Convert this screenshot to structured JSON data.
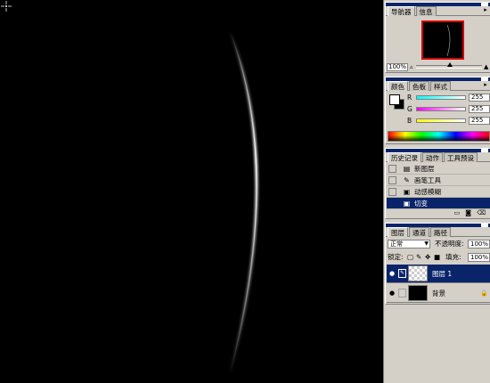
{
  "navigator": {
    "tabs": [
      "导航器",
      "信息"
    ],
    "zoom": "100%",
    "zoom_out_icon": "mountain-small-icon",
    "zoom_in_icon": "mountain-large-icon"
  },
  "color": {
    "tabs": [
      "颜色",
      "色板",
      "样式"
    ],
    "channels": [
      {
        "label": "R",
        "value": "255",
        "gradient": "#00ffff"
      },
      {
        "label": "G",
        "value": "255",
        "gradient": "#ff00ff"
      },
      {
        "label": "B",
        "value": "255",
        "gradient": "#ffff00"
      }
    ],
    "foreground": "#ffffff",
    "background": "#000000"
  },
  "history": {
    "tabs": [
      "历史记录",
      "动作",
      "工具预设"
    ],
    "items": [
      {
        "label": "新图层",
        "icon": "new-layer-icon",
        "selected": false
      },
      {
        "label": "画笔工具",
        "icon": "brush-icon",
        "selected": false
      },
      {
        "label": "动感模糊",
        "icon": "filter-icon",
        "selected": false
      },
      {
        "label": "切变",
        "icon": "filter-icon",
        "selected": true
      }
    ]
  },
  "layers": {
    "tabs": [
      "图层",
      "通道",
      "路径"
    ],
    "blend_mode": "正常",
    "opacity_label": "不透明度:",
    "opacity_value": "100%",
    "lock_label": "锁定:",
    "fill_label": "填充:",
    "fill_value": "100%",
    "items": [
      {
        "name": "图层 1",
        "selected": true,
        "thumbnail": "transparent"
      },
      {
        "name": "背景",
        "selected": false,
        "thumbnail": "black",
        "locked": true
      }
    ]
  },
  "colors": {
    "canvas": "#000000",
    "selection": "#0a246a",
    "panel": "#d4d0c8",
    "nav_frame": "#d00000"
  }
}
